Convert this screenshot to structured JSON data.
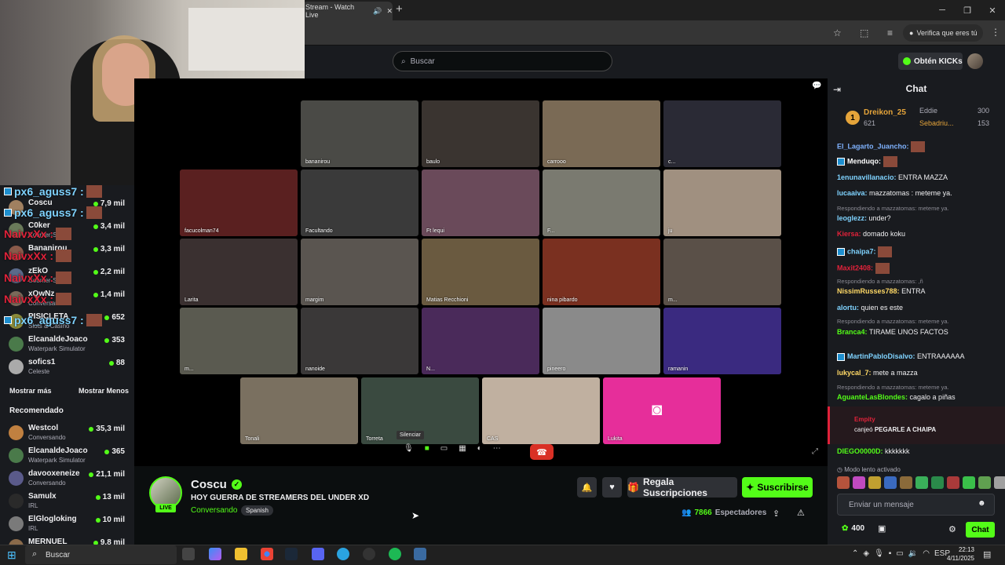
{
  "browser": {
    "tab_title": "Stream - Watch Live",
    "verify_label": "Verifica que eres tú"
  },
  "header": {
    "search_placeholder": "Buscar",
    "kicks_label": "Obtén KICKs"
  },
  "overlay_users": [
    {
      "name": "px6_aguss7 :",
      "style": "blue"
    },
    {
      "name": "px6_aguss7 :",
      "style": "blue"
    },
    {
      "name": "NaivxXx :",
      "style": "red"
    },
    {
      "name": "NaivxXx :",
      "style": "red"
    },
    {
      "name": "NaivxXx :",
      "style": "red"
    },
    {
      "name": "NaivxXx :",
      "style": "red"
    },
    {
      "name": "px6_aguss7 :",
      "style": "blue"
    }
  ],
  "sidebar": {
    "following": [
      {
        "name": "Coscu",
        "game": "",
        "viewers": "7,9 mil"
      },
      {
        "name": "C0ker",
        "game": "Counter-Strike",
        "viewers": "3,4 mil"
      },
      {
        "name": "Bananirou",
        "game": "",
        "viewers": "3,3 mil"
      },
      {
        "name": "zEkO",
        "game": "Counter-Strike",
        "viewers": "2,2 mil"
      },
      {
        "name": "xQwNz",
        "game": "Conversando",
        "viewers": "1,4 mil"
      },
      {
        "name": "PISICLETA",
        "game": "Slots & Casino",
        "viewers": "652"
      },
      {
        "name": "ElcanaldeJoaco",
        "game": "Waterpark Simulator",
        "viewers": "353"
      },
      {
        "name": "sofics1",
        "game": "Celeste",
        "viewers": "88"
      }
    ],
    "show_more": "Mostrar más",
    "show_less": "Mostrar Menos",
    "recommended_title": "Recomendado",
    "recommended": [
      {
        "name": "Westcol",
        "game": "Conversando",
        "viewers": "35,3 mil"
      },
      {
        "name": "ElcanaldeJoaco",
        "game": "Waterpark Simulator",
        "viewers": "365"
      },
      {
        "name": "davooxeneize",
        "game": "Conversando",
        "viewers": "21,1 mil"
      },
      {
        "name": "Samulx",
        "game": "IRL",
        "viewers": "13 mil"
      },
      {
        "name": "ElGlogloking",
        "game": "IRL",
        "viewers": "10 mil"
      },
      {
        "name": "MERNUEL",
        "game": "",
        "viewers": "9,8 mil"
      }
    ]
  },
  "video": {
    "tiles": [
      {
        "label": "bananirou"
      },
      {
        "label": "baulo"
      },
      {
        "label": "carrooo"
      },
      {
        "label": "c..."
      },
      {
        "label": "facucolman74"
      },
      {
        "label": "Facultando"
      },
      {
        "label": "Ft lequi"
      },
      {
        "label": "F..."
      },
      {
        "label": "ju"
      },
      {
        "label": "Larita"
      },
      {
        "label": "margim"
      },
      {
        "label": "Matias Recchioni"
      },
      {
        "label": "nina pibardo"
      },
      {
        "label": "m..."
      },
      {
        "label": "m..."
      },
      {
        "label": "nanoide"
      },
      {
        "label": "N..."
      },
      {
        "label": "pineero"
      },
      {
        "label": "ramanin"
      },
      {
        "label": "Tonali"
      },
      {
        "label": "Torreta"
      },
      {
        "label": "CAS"
      },
      {
        "label": "Lukita"
      }
    ],
    "tooltip": "Silenciar"
  },
  "stream": {
    "streamer": "Coscu",
    "live_badge": "LIVE",
    "title": "HOY GUERRA DE STREAMERS DEL UNDER XD",
    "category": "Conversando",
    "language": "Spanish",
    "gift_label": "Regala Suscripciones",
    "subscribe_label": "Suscribirse",
    "viewer_count": "7866",
    "viewer_label": "Espectadores"
  },
  "chat": {
    "title": "Chat",
    "leaderboard": [
      {
        "rank": "1",
        "name": "Dreikon_25",
        "value": "621"
      },
      {
        "name": "Eddie",
        "value": "300"
      },
      {
        "name": "Sebadriu...",
        "value": "153"
      }
    ],
    "messages": [
      {
        "user": "El_Lagarto_Juancho:",
        "text": "",
        "color": "#7fb3ff"
      },
      {
        "user": "Menduqo:",
        "text": "",
        "color": "#ffffff"
      },
      {
        "user": "1enunavillanacio:",
        "text": "ENTRA MAZZA",
        "color": "#7fd3ff"
      },
      {
        "user": "lucaaiva:",
        "text": "mazzatomas : meteme ya.",
        "color": "#7fd3ff"
      },
      {
        "reply": "Respondiendo a mazzatomas: meteme ya."
      },
      {
        "user": "leoglezz:",
        "text": "under?",
        "color": "#7fd3ff"
      },
      {
        "user": "Kiersa:",
        "text": "domado koku",
        "color": "#e0223a"
      },
      {
        "user": "chaipa7:",
        "text": "",
        "color": "#7fd3ff"
      },
      {
        "user": "Maxit2408:",
        "text": "",
        "color": "#e0223a"
      },
      {
        "reply": "Respondiendo a mazzatomas: ,ñ"
      },
      {
        "user": "NissimRusses788:",
        "text": "ENTRA",
        "color": "#ffd966"
      },
      {
        "user": "alortu:",
        "text": "quien es este",
        "color": "#7fd3ff"
      },
      {
        "reply": "Respondiendo a mazzatomas: meteme ya."
      },
      {
        "user": "Branca4:",
        "text": "TIRAME UNOS FACTOS",
        "color": "#53fc18"
      },
      {
        "user": "MartinPabloDisalvo:",
        "text": "ENTRAAAAAA",
        "color": "#7fd3ff"
      },
      {
        "user": "lukycal_7:",
        "text": "mete a mazza",
        "color": "#ffd966"
      },
      {
        "reply": "Respondiendo a mazzatomas: meteme ya."
      },
      {
        "user": "AguanteLasBlondes:",
        "text": "cagalo a piñas",
        "color": "#53fc18"
      }
    ],
    "highlight_user": "Empity",
    "highlight_text_pre": "canjeó",
    "highlight_text_bold": "PEGARLE A CHAIPA",
    "last_user": "DIEGO0000D:",
    "last_text": "kkkkkkk",
    "slow_mode": "Modo lento activado",
    "input_placeholder": "Enviar un mensaje",
    "points": "400",
    "send_label": "Chat"
  },
  "taskbar": {
    "search_placeholder": "Buscar",
    "lang": "ESP",
    "time": "22:13",
    "date": "4/11/2025"
  }
}
